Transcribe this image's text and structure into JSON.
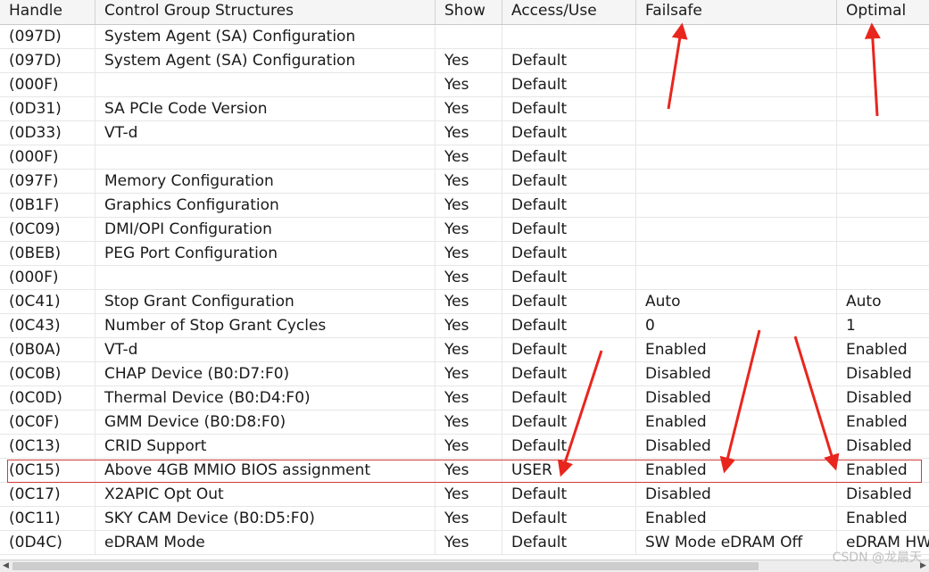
{
  "headers": [
    "Handle",
    "Control Group Structures",
    "Show",
    "Access/Use",
    "Failsafe",
    "Optimal"
  ],
  "rows": [
    [
      "(097D)",
      "System Agent (SA) Configuration",
      "",
      "",
      "",
      ""
    ],
    [
      "(097D)",
      "System Agent (SA) Configuration",
      "Yes",
      "Default",
      "",
      ""
    ],
    [
      "(000F)",
      "",
      "Yes",
      "Default",
      "",
      ""
    ],
    [
      "(0D31)",
      "SA PCIe Code Version",
      "Yes",
      "Default",
      "",
      ""
    ],
    [
      "(0D33)",
      "VT-d",
      "Yes",
      "Default",
      "",
      ""
    ],
    [
      "(000F)",
      "",
      "Yes",
      "Default",
      "",
      ""
    ],
    [
      "(097F)",
      "Memory Configuration",
      "Yes",
      "Default",
      "",
      ""
    ],
    [
      "(0B1F)",
      "Graphics Configuration",
      "Yes",
      "Default",
      "",
      ""
    ],
    [
      "(0C09)",
      "DMI/OPI Configuration",
      "Yes",
      "Default",
      "",
      ""
    ],
    [
      "(0BEB)",
      "PEG Port Configuration",
      "Yes",
      "Default",
      "",
      ""
    ],
    [
      "(000F)",
      "",
      "Yes",
      "Default",
      "",
      ""
    ],
    [
      "(0C41)",
      "Stop Grant Configuration",
      "Yes",
      "Default",
      "Auto",
      "Auto"
    ],
    [
      "(0C43)",
      "Number of Stop Grant Cycles",
      "Yes",
      "Default",
      "0",
      "1"
    ],
    [
      "(0B0A)",
      "VT-d",
      "Yes",
      "Default",
      "Enabled",
      "Enabled"
    ],
    [
      "(0C0B)",
      "CHAP Device (B0:D7:F0)",
      "Yes",
      "Default",
      "Disabled",
      "Disabled"
    ],
    [
      "(0C0D)",
      "Thermal Device (B0:D4:F0)",
      "Yes",
      "Default",
      "Disabled",
      "Disabled"
    ],
    [
      "(0C0F)",
      "GMM Device (B0:D8:F0)",
      "Yes",
      "Default",
      "Enabled",
      "Enabled"
    ],
    [
      "(0C13)",
      "CRID Support",
      "Yes",
      "Default",
      "Disabled",
      "Disabled"
    ],
    [
      "(0C15)",
      "Above 4GB MMIO BIOS assignment",
      "Yes",
      "USER",
      "Enabled",
      "Enabled"
    ],
    [
      "(0C17)",
      "X2APIC Opt Out",
      "Yes",
      "Default",
      "Disabled",
      "Disabled"
    ],
    [
      "(0C11)",
      "SKY CAM Device (B0:D5:F0)",
      "Yes",
      "Default",
      "Enabled",
      "Enabled"
    ],
    [
      "(0D4C)",
      "eDRAM Mode",
      "Yes",
      "Default",
      "SW Mode eDRAM Off",
      "eDRAM HW"
    ]
  ],
  "watermark": "CSDN @龙晨天",
  "colors": {
    "annotation": "#e8261e",
    "header_bg": "#f5f5f5",
    "grid_line": "#e6e6e6"
  }
}
